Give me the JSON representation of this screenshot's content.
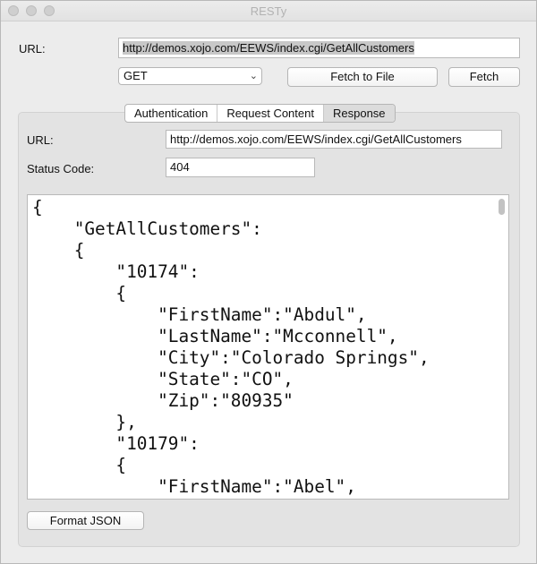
{
  "window": {
    "title": "RESTy"
  },
  "request": {
    "url_label": "URL:",
    "url_value": "http://demos.xojo.com/EEWS/index.cgi/GetAllCustomers",
    "method": "GET",
    "fetch_to_file_label": "Fetch to File",
    "fetch_label": "Fetch"
  },
  "tabs": [
    {
      "label": "Authentication"
    },
    {
      "label": "Request Content"
    },
    {
      "label": "Response",
      "active": true
    }
  ],
  "response": {
    "url_label": "URL:",
    "url_value": "http://demos.xojo.com/EEWS/index.cgi/GetAllCustomers",
    "status_label": "Status Code:",
    "status_value": "404",
    "body": "{\n    \"GetAllCustomers\":\n    {\n        \"10174\":\n        {\n            \"FirstName\":\"Abdul\",\n            \"LastName\":\"Mcconnell\",\n            \"City\":\"Colorado Springs\",\n            \"State\":\"CO\",\n            \"Zip\":\"80935\"\n        },\n        \"10179\":\n        {\n            \"FirstName\":\"Abel\",",
    "format_json_label": "Format JSON"
  },
  "icons": {
    "popup_arrow": "chevron-down-icon"
  }
}
